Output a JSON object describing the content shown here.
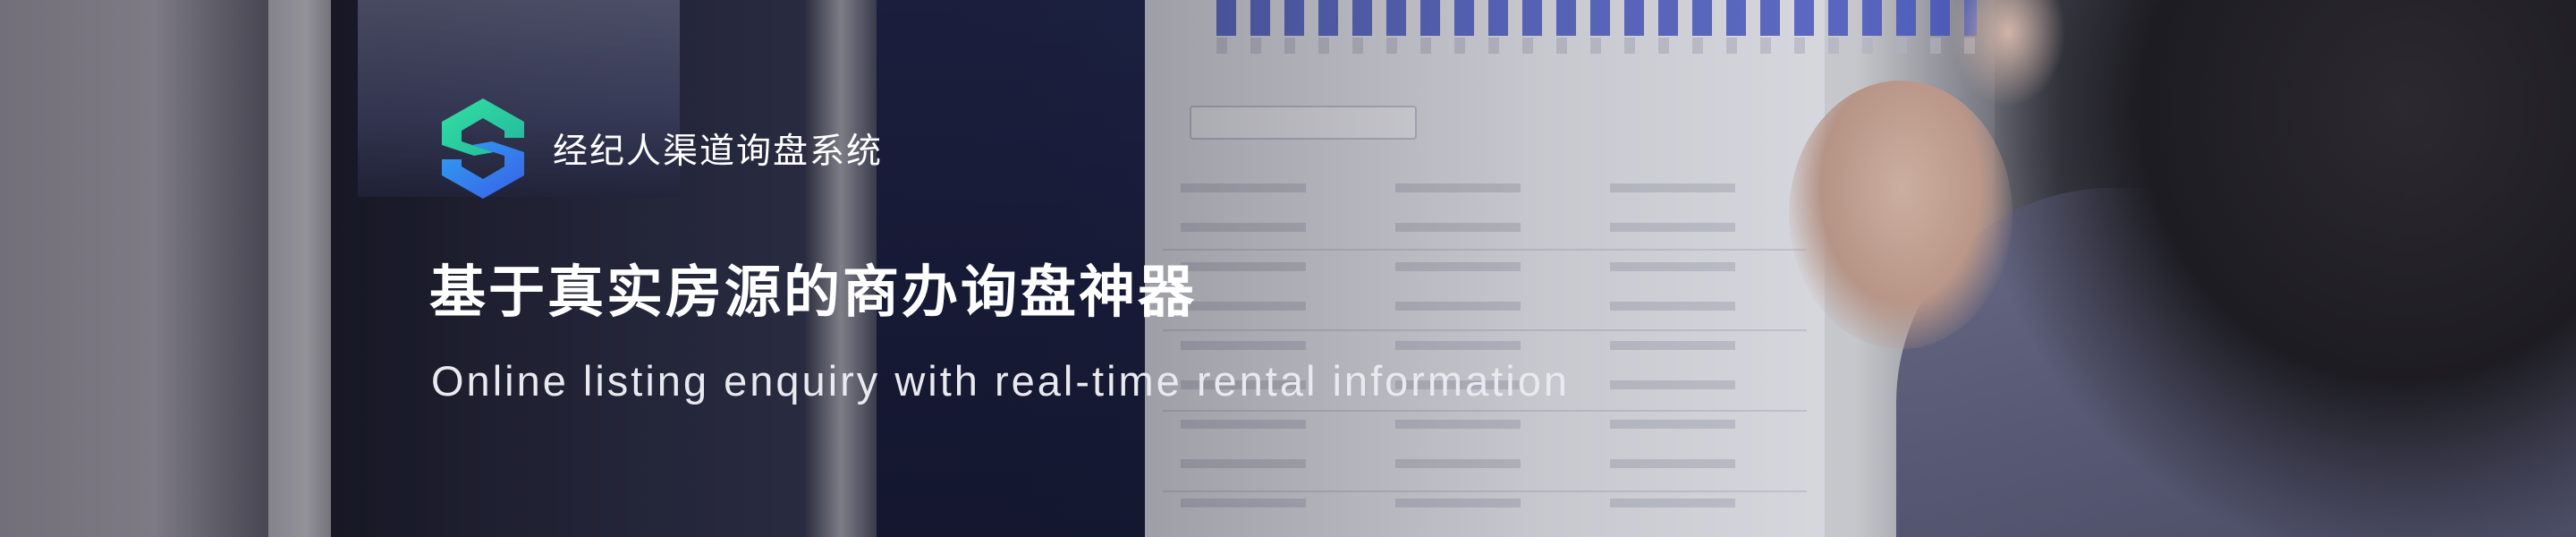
{
  "brand": {
    "name": "经纪人渠道询盘系统",
    "logo_icon": "s-hexagon-logo-icon",
    "colors": {
      "logo_top": "#2ed39a",
      "logo_bottom": "#3a76f0"
    }
  },
  "hero": {
    "headline": "基于真实房源的商办询盘神器",
    "subheadline": "Online listing enquiry with real-time rental information"
  }
}
